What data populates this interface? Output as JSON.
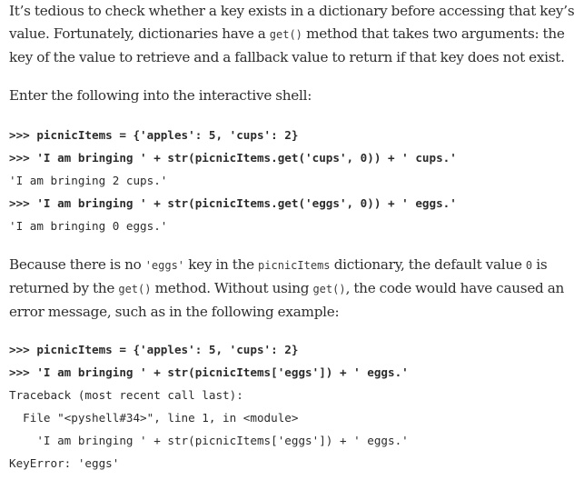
{
  "para1": {
    "t1": "It’s tedious to check whether a key exists in a dictionary before accessing that key’s value. Fortunately, dictionaries have a ",
    "c1": "get()",
    "t2": " method that takes two arguments: the key of the value to retrieve and a fallback value to return if that key does not exist."
  },
  "para2": {
    "t1": "Enter the following into the interactive shell:"
  },
  "code1": [
    {
      "text": ">>> picnicItems = {'apples': 5, 'cups': 2}",
      "bold": true
    },
    {
      "text": ">>> 'I am bringing ' + str(picnicItems.get('cups', 0)) + ' cups.'",
      "bold": true
    },
    {
      "text": "'I am bringing 2 cups.'",
      "bold": false
    },
    {
      "text": ">>> 'I am bringing ' + str(picnicItems.get('eggs', 0)) + ' eggs.'",
      "bold": true
    },
    {
      "text": "'I am bringing 0 eggs.'",
      "bold": false
    }
  ],
  "para3": {
    "t1": "Because there is no ",
    "c1": "'eggs'",
    "t2": " key in the ",
    "c2": "picnicItems",
    "t3": " dictionary, the default value ",
    "c3": "0",
    "t4": " is returned by the ",
    "c4": "get()",
    "t5": " method. Without using ",
    "c5": "get()",
    "t6": ", the code would have caused an error message, such as in the following example:"
  },
  "code2": [
    {
      "text": ">>> picnicItems = {'apples': 5, 'cups': 2}",
      "bold": true
    },
    {
      "text": ">>> 'I am bringing ' + str(picnicItems['eggs']) + ' eggs.'",
      "bold": true
    },
    {
      "text": "Traceback (most recent call last):",
      "bold": false
    },
    {
      "text": "  File \"<pyshell#34>\", line 1, in <module>",
      "bold": false
    },
    {
      "text": "    'I am bringing ' + str(picnicItems['eggs']) + ' eggs.'",
      "bold": false
    },
    {
      "text": "KeyError: 'eggs'",
      "bold": false
    }
  ]
}
